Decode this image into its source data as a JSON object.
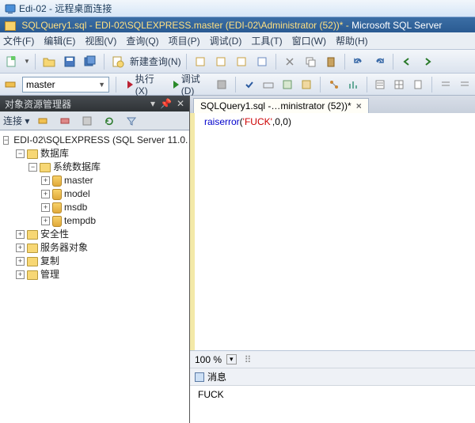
{
  "rdp": {
    "title": "Edi-02 - 远程桌面连接"
  },
  "app": {
    "title_prefix": "SQLQuery1.sql - EDI-02\\SQLEXPRESS.master (EDI-02\\Administrator (52))* - ",
    "title_product": "Microsoft SQL Server"
  },
  "menu": {
    "file": "文件(F)",
    "edit": "编辑(E)",
    "view": "视图(V)",
    "query": "查询(Q)",
    "project": "项目(P)",
    "debug": "调试(D)",
    "tools": "工具(T)",
    "window": "窗口(W)",
    "help": "帮助(H)"
  },
  "toolbar": {
    "new_query": "新建查询(N)"
  },
  "toolbar2": {
    "db_selected": "master",
    "execute": "执行(X)",
    "debug": "调试(D)"
  },
  "panel": {
    "title": "对象资源管理器",
    "connect": "连接 ▾"
  },
  "tree": {
    "server": "EDI-02\\SQLEXPRESS (SQL Server 11.0.",
    "databases": "数据库",
    "sysdb": "系统数据库",
    "dbs": [
      "master",
      "model",
      "msdb",
      "tempdb"
    ],
    "security": "安全性",
    "serverobj": "服务器对象",
    "replication": "复制",
    "management": "管理"
  },
  "editor": {
    "tab": "SQLQuery1.sql -…ministrator (52))*",
    "code_kw": "raiserror",
    "code_punc_open": "(",
    "code_str": "'FUCK'",
    "code_rest": ",0,0)",
    "zoom": "100 %",
    "messages_tab": "消息",
    "message_text": "FUCK"
  }
}
